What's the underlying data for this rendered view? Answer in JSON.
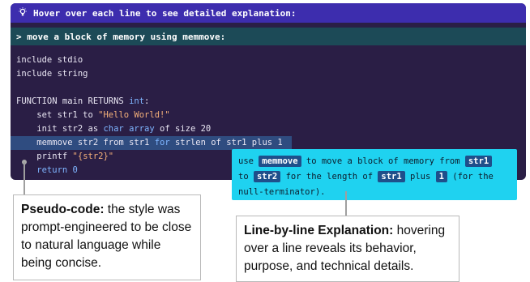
{
  "hint_bar": {
    "icon": "lightbulb-icon",
    "text": "Hover over each line to see detailed explanation:"
  },
  "prompt": {
    "text": "> move a block of memory using memmove:"
  },
  "code": {
    "line1": "include stdio",
    "line2": "include string",
    "fn_prefix": "FUNCTION main RETURNS ",
    "fn_type": "int",
    "fn_suffix": ":",
    "set_prefix": "    set str1 to ",
    "set_str": "\"Hello World!\"",
    "init_prefix": "    init str2 as ",
    "init_type": "char array",
    "init_suffix": " of size 20",
    "mem_prefix": "    memmove str2 from str1 ",
    "mem_for": "for",
    "mem_suffix": " strlen of str1 plus 1",
    "printf_prefix": "    printf ",
    "printf_str": "\"{str2}\"",
    "return_line": "    return 0"
  },
  "tooltip": {
    "t1": "use ",
    "c1": "memmove",
    "t2": " to move a block of memory from ",
    "c2": "str1",
    "t3": "to ",
    "c3": "str2",
    "t4": " for the length of ",
    "c4": "str1",
    "t5": " plus ",
    "c5": "1",
    "t6": " (for the",
    "t7": "null-terminator)."
  },
  "callout_left": {
    "bold": "Pseudo-code:",
    "text": " the style was prompt-engineered to be close to natural language while being concise."
  },
  "callout_right": {
    "bold": "Line-by-line Explanation:",
    "text": " hovering over a line reveals its behavior, purpose, and technical details."
  }
}
